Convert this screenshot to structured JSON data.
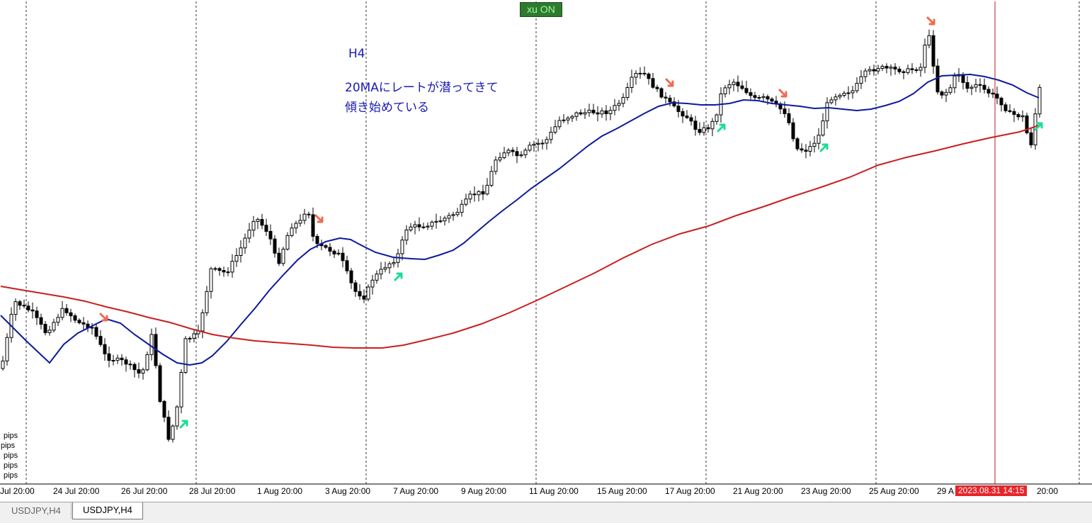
{
  "annotation": {
    "timeframe": "H4",
    "line1": "20MAにレートが潜ってきて",
    "line2": "傾き始めている"
  },
  "badge": {
    "label": "xu ON"
  },
  "pips_labels": [
    "pips",
    "pips",
    "pips",
    "pips",
    "pips"
  ],
  "time_axis": {
    "labels": [
      "Jul 20:00",
      "24 Jul 20:00",
      "26 Jul 20:00",
      "28 Jul 20:00",
      "1 Aug 20:00",
      "3 Aug 20:00",
      "7 Aug 20:00",
      "9 Aug 20:00",
      "11 Aug 20:00",
      "15 Aug 20:00",
      "17 Aug 20:00",
      "21 Aug 20:00",
      "23 Aug 20:00",
      "25 Aug 20:00",
      "29 A",
      "20:00"
    ],
    "crosshair_label": "2023.08.31 14:15"
  },
  "tabs": [
    {
      "label": "USDJPY,H4",
      "active": false
    },
    {
      "label": "USDJPY,H4",
      "active": true
    }
  ],
  "colors": {
    "ma20": "#0d1a9c",
    "ma_long": "#c8201e",
    "sell_arrow": "#f06a4f",
    "buy_arrow": "#1ddc93",
    "crosshair": "#b22222"
  },
  "chart_data": {
    "type": "candlestick",
    "symbol": "USDJPY",
    "timeframe": "H4",
    "series": [
      {
        "name": "",
        "points": [
          [
            1,
            445
          ],
          [
            18,
            462
          ],
          [
            36,
            480
          ],
          [
            54,
            497
          ],
          [
            70,
            512
          ],
          [
            90,
            486
          ],
          [
            110,
            470
          ],
          [
            130,
            460
          ],
          [
            150,
            450
          ],
          [
            170,
            456
          ],
          [
            190,
            472
          ],
          [
            210,
            486
          ],
          [
            230,
            500
          ],
          [
            250,
            512
          ],
          [
            268,
            515
          ],
          [
            285,
            512
          ],
          [
            300,
            502
          ],
          [
            320,
            482
          ],
          [
            340,
            458
          ],
          [
            360,
            435
          ],
          [
            380,
            410
          ],
          [
            400,
            388
          ],
          [
            420,
            367
          ],
          [
            438,
            352
          ],
          [
            460,
            341
          ],
          [
            480,
            336
          ],
          [
            495,
            338
          ],
          [
            510,
            346
          ],
          [
            530,
            356
          ],
          [
            555,
            363
          ],
          [
            580,
            365
          ],
          [
            600,
            366
          ],
          [
            620,
            360
          ],
          [
            640,
            353
          ],
          [
            655,
            343
          ],
          [
            670,
            330
          ],
          [
            690,
            313
          ],
          [
            710,
            297
          ],
          [
            730,
            282
          ],
          [
            750,
            266
          ],
          [
            770,
            252
          ],
          [
            790,
            238
          ],
          [
            810,
            222
          ],
          [
            830,
            206
          ],
          [
            850,
            192
          ],
          [
            870,
            182
          ],
          [
            890,
            171
          ],
          [
            910,
            160
          ],
          [
            930,
            150
          ],
          [
            950,
            145
          ],
          [
            970,
            146
          ],
          [
            990,
            148
          ],
          [
            1010,
            148
          ],
          [
            1030,
            146
          ],
          [
            1050,
            141
          ],
          [
            1070,
            142
          ],
          [
            1090,
            146
          ],
          [
            1110,
            148
          ],
          [
            1130,
            150
          ],
          [
            1150,
            153
          ],
          [
            1170,
            152
          ],
          [
            1190,
            154
          ],
          [
            1210,
            156
          ],
          [
            1230,
            154
          ],
          [
            1250,
            149
          ],
          [
            1270,
            143
          ],
          [
            1290,
            132
          ],
          [
            1310,
            116
          ],
          [
            1330,
            107
          ],
          [
            1350,
            106
          ],
          [
            1370,
            105
          ],
          [
            1390,
            108
          ],
          [
            1410,
            113
          ],
          [
            1430,
            120
          ],
          [
            1450,
            131
          ],
          [
            1467,
            138
          ]
        ]
      },
      {
        "name": "",
        "points": [
          [
            1,
            404
          ],
          [
            30,
            409
          ],
          [
            60,
            414
          ],
          [
            90,
            419
          ],
          [
            120,
            425
          ],
          [
            150,
            433
          ],
          [
            180,
            440
          ],
          [
            210,
            448
          ],
          [
            240,
            455
          ],
          [
            270,
            464
          ],
          [
            300,
            472
          ],
          [
            330,
            477
          ],
          [
            360,
            481
          ],
          [
            400,
            484
          ],
          [
            440,
            487
          ],
          [
            470,
            490
          ],
          [
            500,
            491
          ],
          [
            540,
            491
          ],
          [
            570,
            487
          ],
          [
            600,
            480
          ],
          [
            640,
            470
          ],
          [
            680,
            457
          ],
          [
            720,
            441
          ],
          [
            760,
            423
          ],
          [
            800,
            404
          ],
          [
            840,
            385
          ],
          [
            880,
            364
          ],
          [
            920,
            345
          ],
          [
            960,
            330
          ],
          [
            1000,
            319
          ],
          [
            1040,
            304
          ],
          [
            1080,
            291
          ],
          [
            1120,
            277
          ],
          [
            1160,
            264
          ],
          [
            1200,
            250
          ],
          [
            1240,
            233
          ],
          [
            1280,
            222
          ],
          [
            1320,
            213
          ],
          [
            1360,
            203
          ],
          [
            1400,
            194
          ],
          [
            1440,
            186
          ],
          [
            1467,
            177
          ]
        ]
      }
    ]
  }
}
